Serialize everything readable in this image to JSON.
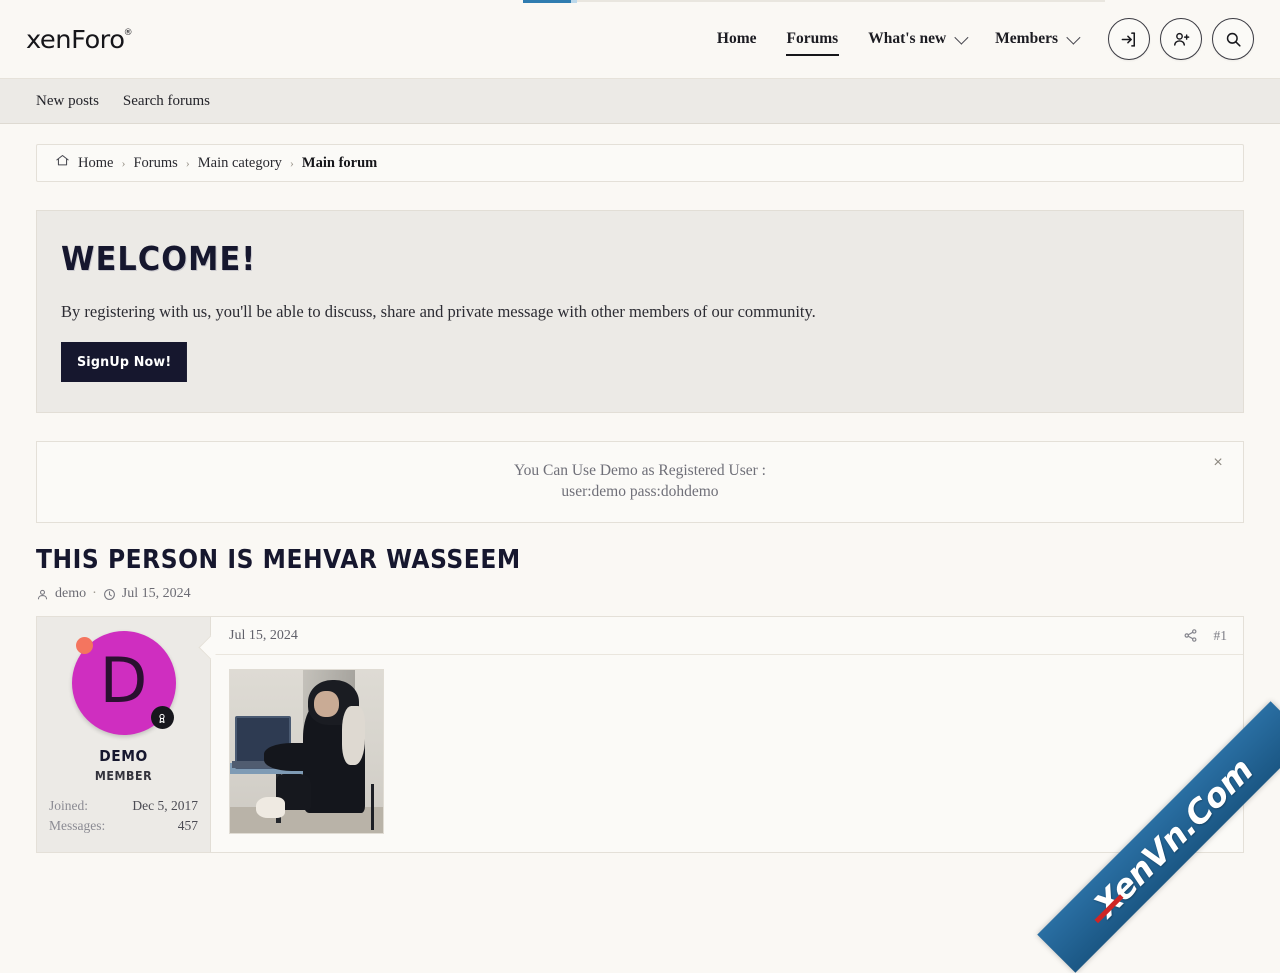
{
  "site": {
    "logo_text": "xenForo",
    "logo_registered_mark": "®"
  },
  "header": {
    "nav": [
      {
        "label": "Home",
        "has_dropdown": false,
        "active": false
      },
      {
        "label": "Forums",
        "has_dropdown": false,
        "active": true
      },
      {
        "label": "What's new",
        "has_dropdown": true,
        "active": false
      },
      {
        "label": "Members",
        "has_dropdown": true,
        "active": false
      }
    ],
    "buttons": [
      {
        "name": "login-button",
        "icon": "sign-in-icon"
      },
      {
        "name": "register-button",
        "icon": "user-plus-icon"
      },
      {
        "name": "search-button",
        "icon": "search-icon"
      }
    ]
  },
  "subnav": {
    "items": [
      {
        "label": "New posts"
      },
      {
        "label": "Search forums"
      }
    ]
  },
  "breadcrumb": {
    "home_icon": "home-icon",
    "items": [
      {
        "label": "Home",
        "current": false
      },
      {
        "label": "Forums",
        "current": false
      },
      {
        "label": "Main category",
        "current": false
      },
      {
        "label": "Main forum",
        "current": true
      }
    ],
    "separator": "›"
  },
  "welcome": {
    "heading": "WELCOME!",
    "body": "By registering with us, you'll be able to discuss, share and private message with other members of our community.",
    "button_label": "SignUp Now!"
  },
  "notice": {
    "line1": "You Can Use Demo as Registered User :",
    "line2": "user:demo pass:dohdemo",
    "close_label": "×"
  },
  "thread": {
    "title": "THIS PERSON IS MEHVAR WASSEEM",
    "author": "demo",
    "meta_separator": "·",
    "date": "Jul 15, 2024"
  },
  "post": {
    "date": "Jul 15, 2024",
    "number": "#1",
    "share_icon": "share-icon",
    "author": {
      "avatar_letter": "D",
      "avatar_color": "#cf2ec0",
      "online_indicator_color": "#f4755f",
      "username": "DEMO",
      "user_title": "MEMBER",
      "stats": [
        {
          "label": "Joined:",
          "value": "Dec 5, 2017"
        },
        {
          "label": "Messages:",
          "value": "457"
        }
      ]
    },
    "attachment_alt": "Person sitting at desk with laptop"
  },
  "watermark": {
    "text": "XenVn.Com",
    "color": "#1b5784"
  }
}
